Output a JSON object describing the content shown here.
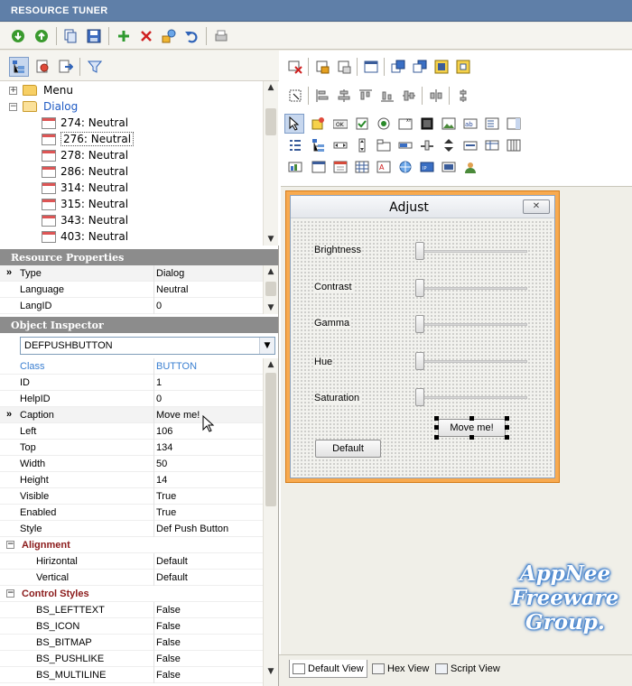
{
  "app": {
    "title": "RESOURCE TUNER"
  },
  "toolbar": {
    "icons": [
      "arrow-down-icon",
      "arrow-up-icon",
      "copy-icon",
      "save-icon",
      "add-icon",
      "delete-icon",
      "wizard-icon",
      "undo-icon",
      "print-icon"
    ]
  },
  "tree": {
    "items": [
      {
        "label": "Menu",
        "type": "folder",
        "expanded": false
      },
      {
        "label": "Dialog",
        "type": "folder",
        "expanded": true
      },
      {
        "label": "274: Neutral"
      },
      {
        "label": "276: Neutral",
        "selected": true
      },
      {
        "label": "278: Neutral"
      },
      {
        "label": "286: Neutral"
      },
      {
        "label": "314: Neutral"
      },
      {
        "label": "315: Neutral"
      },
      {
        "label": "343: Neutral"
      },
      {
        "label": "403: Neutral"
      }
    ]
  },
  "resource_properties": {
    "title": "Resource Properties",
    "rows": [
      {
        "key": "Type",
        "value": "Dialog"
      },
      {
        "key": "Language",
        "value": "Neutral"
      },
      {
        "key": "LangID",
        "value": "0"
      }
    ]
  },
  "object_inspector": {
    "title": "Object Inspector",
    "selected_object": "DEFPUSHBUTTON",
    "rows": [
      {
        "key": "Class",
        "value": "BUTTON"
      },
      {
        "key": "ID",
        "value": "1"
      },
      {
        "key": "HelpID",
        "value": "0"
      },
      {
        "key": "Caption",
        "value": "Move me!"
      },
      {
        "key": "Left",
        "value": "106"
      },
      {
        "key": "Top",
        "value": "134"
      },
      {
        "key": "Width",
        "value": "50"
      },
      {
        "key": "Height",
        "value": "14"
      },
      {
        "key": "Visible",
        "value": "True"
      },
      {
        "key": "Enabled",
        "value": "True"
      },
      {
        "key": "Style",
        "value": "Def Push Button"
      },
      {
        "key": "Alignment",
        "value": ""
      },
      {
        "key": "Hirizontal",
        "value": "Default"
      },
      {
        "key": "Vertical",
        "value": "Default"
      },
      {
        "key": "Control Styles",
        "value": ""
      },
      {
        "key": "BS_LEFTTEXT",
        "value": "False"
      },
      {
        "key": "BS_ICON",
        "value": "False"
      },
      {
        "key": "BS_BITMAP",
        "value": "False"
      },
      {
        "key": "BS_PUSHLIKE",
        "value": "False"
      },
      {
        "key": "BS_MULTILINE",
        "value": "False"
      }
    ]
  },
  "dialog_preview": {
    "title": "Adjust",
    "close_glyph": "✕",
    "sliders": [
      "Brightness",
      "Contrast",
      "Gamma",
      "Hue",
      "Saturation"
    ],
    "move_button": "Move me!",
    "default_button": "Default"
  },
  "tabs": [
    "Default View",
    "Hex View",
    "Script View"
  ],
  "watermark": {
    "line1": "AppNee",
    "line2": "Freeware",
    "line3": "Group."
  }
}
